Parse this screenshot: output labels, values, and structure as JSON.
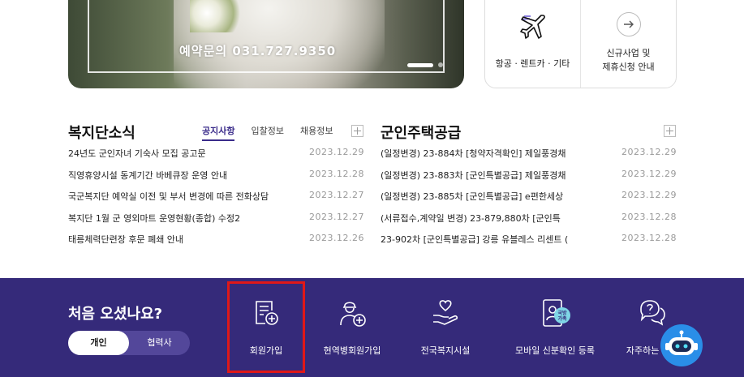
{
  "banner": {
    "phone_text": "예약문의 031.727.9350"
  },
  "quick_links": [
    {
      "icon": "airplane-icon",
      "label": "항공 · 렌트카 · 기타"
    },
    {
      "icon": "arrow-right-icon",
      "label_line1": "신규사업 및",
      "label_line2": "제휴신청 안내"
    }
  ],
  "welfare_news": {
    "title": "복지단소식",
    "tabs": [
      "공지사항",
      "입찰정보",
      "채용정보"
    ],
    "active_tab": "공지사항",
    "items": [
      {
        "title": "24년도 군인자녀 기숙사 모집 공고문",
        "date": "2023.12.29"
      },
      {
        "title": "직영휴양시설 동계기간 바베큐장 운영 안내",
        "date": "2023.12.28"
      },
      {
        "title": "국군복지단 예약실 이전 및 부서 변경에 따른 전화상담",
        "date": "2023.12.27"
      },
      {
        "title": "복지단 1월 군 영외마트 운영현황(종합) 수정2",
        "date": "2023.12.27"
      },
      {
        "title": "태릉체력단련장 후문 폐쇄 안내",
        "date": "2023.12.26"
      }
    ]
  },
  "housing": {
    "title": "군인주택공급",
    "items": [
      {
        "title": "(일정변경) 23-884차 [청약자격확인] 제일풍경채",
        "date": "2023.12.29"
      },
      {
        "title": "(일정변경) 23-883차 [군인특별공급] 제일풍경채",
        "date": "2023.12.29"
      },
      {
        "title": "(일정변경) 23-885차 [군인특별공급] e편한세상",
        "date": "2023.12.29"
      },
      {
        "title": "(서류접수,계약일 변경) 23-879,880차 [군인특",
        "date": "2023.12.28"
      },
      {
        "title": "23-902차 [군인특별공급] 강릉 유블레스 리센트 (",
        "date": "2023.12.28"
      }
    ]
  },
  "footer": {
    "welcome": "처음 오셨나요?",
    "toggle": [
      "개인",
      "협력사"
    ],
    "toggle_selected": "개인",
    "services": [
      {
        "icon": "document-plus-icon",
        "label": "회원가입"
      },
      {
        "icon": "soldier-plus-icon",
        "label": "현역병회원가입"
      },
      {
        "icon": "hand-heart-icon",
        "label": "전국복지시설"
      },
      {
        "icon": "mobile-id-icon",
        "badge": "국방\n가족",
        "label": "모바일 신분확인 등록"
      },
      {
        "icon": "faq-chat-icon",
        "label": "자주하는 질문"
      }
    ],
    "chatbot_icon": "chatbot-icon"
  },
  "colors": {
    "brand_purple": "#352a7a",
    "highlight_red": "#e01818",
    "chatbot_blue": "#2a8ee8"
  }
}
